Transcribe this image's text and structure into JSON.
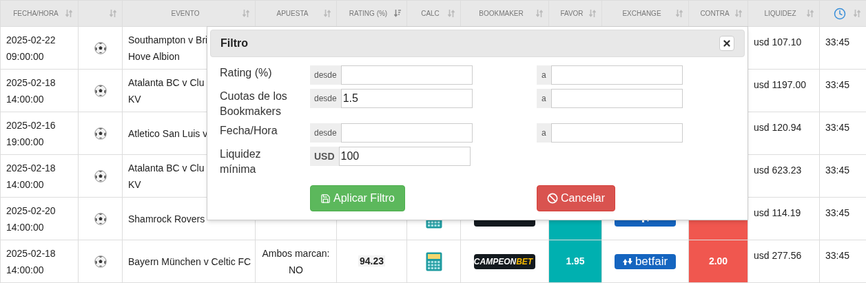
{
  "table": {
    "columns": [
      {
        "kind": "text",
        "label": "FECHA/HORA",
        "sorted": false
      },
      {
        "kind": "blank",
        "sorted": false
      },
      {
        "kind": "text",
        "label": "EVENTO",
        "sorted": false
      },
      {
        "kind": "text",
        "label": "APUESTA",
        "sorted": false
      },
      {
        "kind": "text",
        "label": "RATING (%)",
        "sorted": true
      },
      {
        "kind": "text",
        "label": "CALC",
        "sorted": false
      },
      {
        "kind": "text",
        "label": "BOOKMAKER",
        "sorted": false
      },
      {
        "kind": "text",
        "label": "FAVOR",
        "sorted": false
      },
      {
        "kind": "text",
        "label": "EXCHANGE",
        "sorted": false
      },
      {
        "kind": "text",
        "label": "CONTRA",
        "sorted": false
      },
      {
        "kind": "text",
        "label": "LIQUIDEZ",
        "sorted": false
      },
      {
        "kind": "clock",
        "sorted": false
      }
    ],
    "rows": [
      {
        "datetime": "2025-02-22 09:00:00",
        "event_lines": [
          "Southampton v Bri",
          "Hove Albion"
        ],
        "liquidity": "usd 107.10",
        "time": "33:45"
      },
      {
        "datetime": "2025-02-18 14:00:00",
        "event_lines": [
          "Atalanta BC v Clu",
          "KV"
        ],
        "liquidity": "usd 1197.00",
        "time": "33:45"
      },
      {
        "datetime": "2025-02-16 19:00:00",
        "event_lines": [
          "Atletico San Luis v"
        ],
        "liquidity": "usd 120.94",
        "time": "33:45"
      },
      {
        "datetime": "2025-02-18 14:00:00",
        "event_lines": [
          "Atalanta BC v Clu",
          "KV"
        ],
        "liquidity": "usd 623.23",
        "time": "33:45"
      },
      {
        "datetime": "2025-02-20 14:00:00",
        "event_lines": [
          "Shamrock Rovers"
        ],
        "liquidity": "usd 114.19",
        "time": "33:45"
      },
      {
        "datetime": "2025-02-18 14:00:00",
        "event_lines": [
          "Bayern München v Celtic FC"
        ],
        "bet": "Ambos marcan: NO",
        "rating": "94.23",
        "bookmaker": [
          "CAMPEON",
          "BET"
        ],
        "favor": "1.95",
        "exchange": "betfair",
        "contra": "2.00",
        "liquidity": "usd 277.56",
        "time": "33:45"
      }
    ]
  },
  "modal": {
    "title": "Filtro",
    "fields": [
      {
        "kind": "range",
        "label": "Rating (%)",
        "from_addon": "desde",
        "to_addon": "a"
      },
      {
        "kind": "range",
        "label": "Cuotas de los Bookmakers",
        "from_addon": "desde",
        "from_value": "1.5",
        "to_addon": "a"
      },
      {
        "kind": "range",
        "label": "Fecha/Hora",
        "from_addon": "desde",
        "to_addon": "a"
      },
      {
        "kind": "single",
        "label": "Liquidez mínima",
        "from_addon": "USD",
        "from_value": "100"
      }
    ],
    "apply_button": "Aplicar Filtro",
    "cancel_button": "Cancelar"
  }
}
